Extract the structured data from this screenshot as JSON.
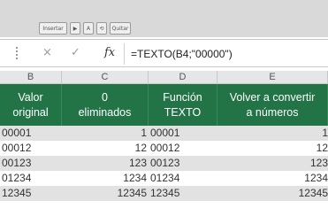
{
  "toolbar": {
    "buttons": [
      "Insertar",
      "▶",
      "A",
      "⟲",
      "Quitar"
    ]
  },
  "formula_bar": {
    "cancel_icon": "×",
    "enter_icon": "✓",
    "fx_label": "fx",
    "formula": "=TEXTO(B4;\"00000\")"
  },
  "columns": [
    "B",
    "C",
    "D",
    "E"
  ],
  "headers": {
    "b": "Valor\noriginal",
    "c": "0\neliminados",
    "d": "Función\nTEXTO",
    "e": "Volver a convertir\na números"
  },
  "rows": [
    {
      "b": "00001",
      "c": "1",
      "d": "00001",
      "e": "1"
    },
    {
      "b": "00012",
      "c": "12",
      "d": "00012",
      "e": "12"
    },
    {
      "b": "00123",
      "c": "123",
      "d": "00123",
      "e": "123"
    },
    {
      "b": "01234",
      "c": "1234",
      "d": "01234",
      "e": "1234"
    },
    {
      "b": "12345",
      "c": "12345",
      "d": "12345",
      "e": "12345"
    }
  ],
  "colors": {
    "header_green": "#227447",
    "band_gray": "#e2e2e2"
  }
}
